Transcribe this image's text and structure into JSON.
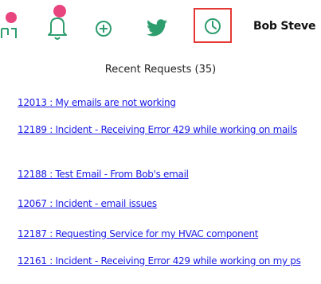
{
  "toolbar": {
    "accent_color": "#2e9d6e",
    "badge_color": "#e8457f",
    "active_border_color": "#e53935",
    "items": [
      {
        "icon": "notification-icon",
        "state": "partially-visible"
      },
      {
        "icon": "bell-icon"
      },
      {
        "icon": "add-circle-icon"
      },
      {
        "icon": "twitter-icon"
      },
      {
        "icon": "history-clock-icon",
        "active": true
      }
    ],
    "user_name": "Bob Steve"
  },
  "recent_requests": {
    "title": "Recent Requests (35)",
    "link_color": "#1a1ae6",
    "items": [
      {
        "label": "12013 : My emails are not working"
      },
      {
        "label": "12189 : Incident - Receiving Error 429 while working on mails"
      },
      {
        "label": "12188 : Test Email - From Bob's email"
      },
      {
        "label": "12067 : Incident - email issues"
      },
      {
        "label": "12187 : Requesting Service for my HVAC component"
      },
      {
        "label": "12161 : Incident - Receiving Error 429 while working on my ps"
      }
    ]
  }
}
